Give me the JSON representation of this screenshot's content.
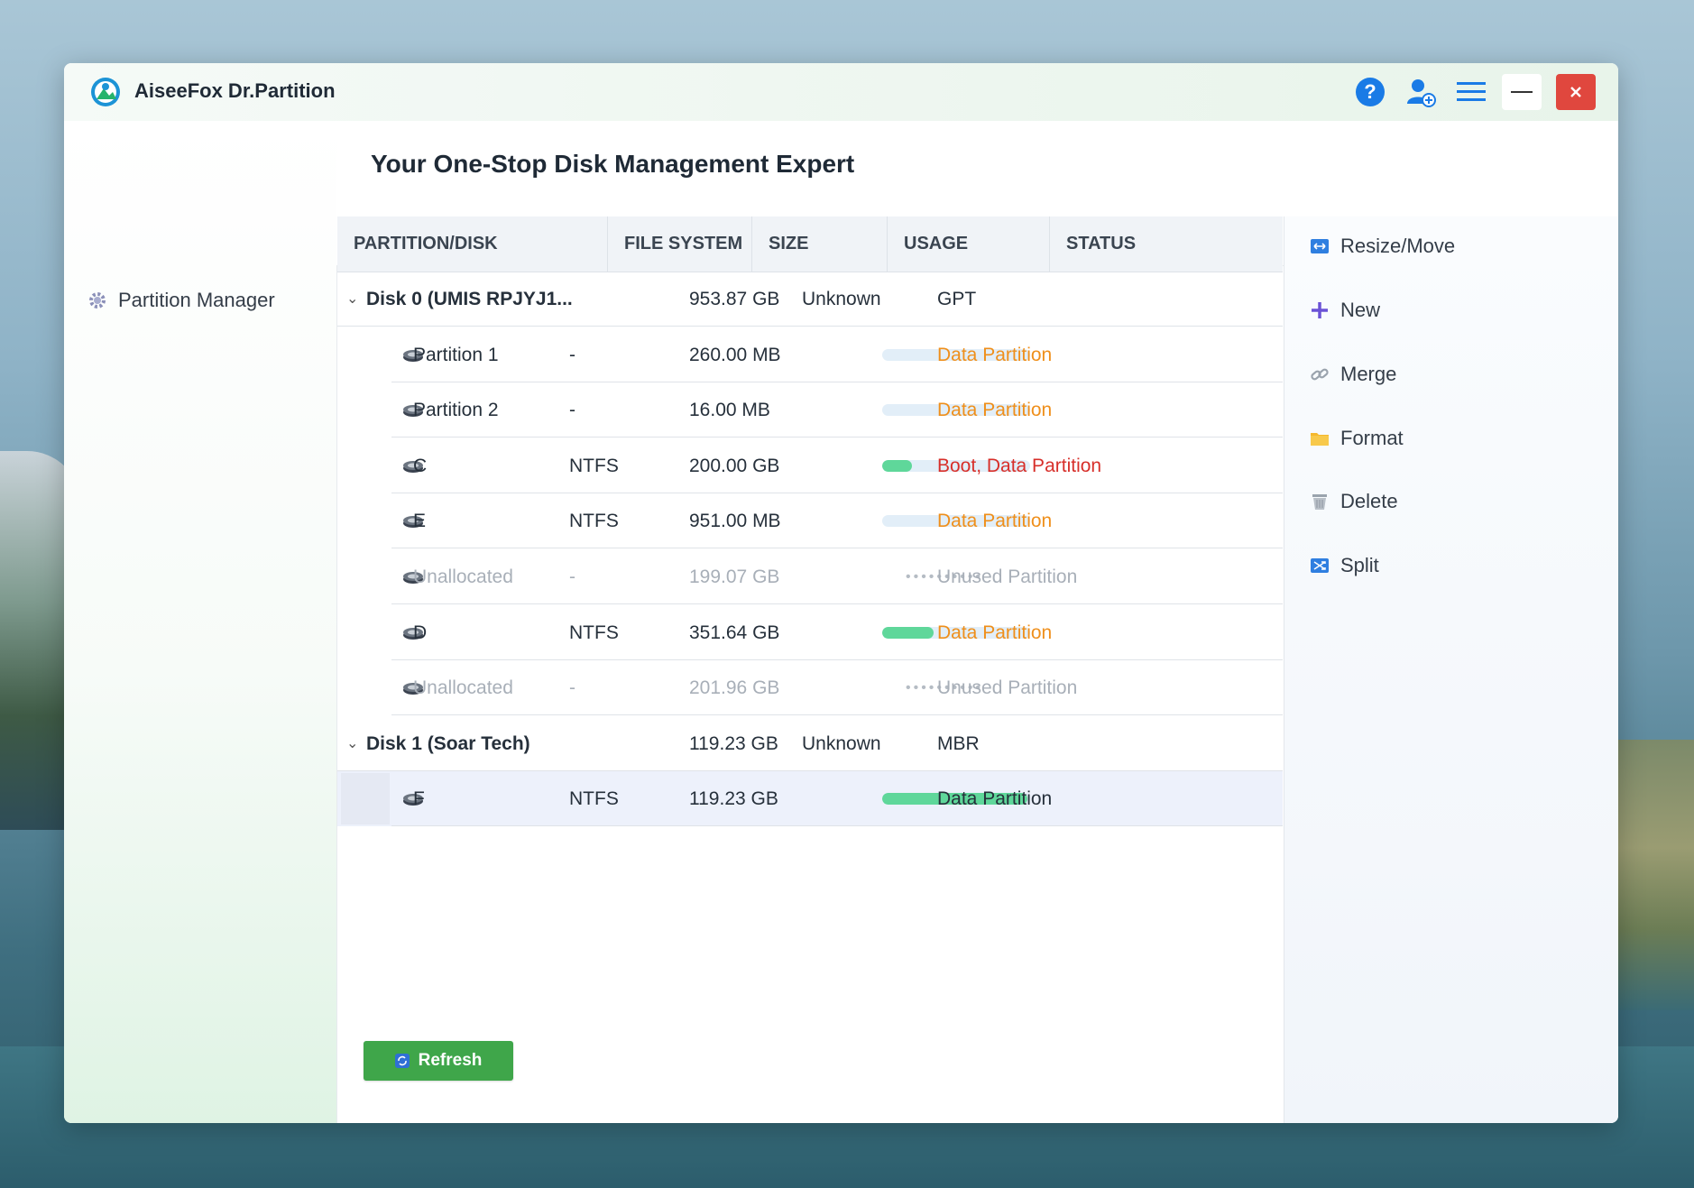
{
  "app": {
    "title": "AiseeFox Dr.Partition"
  },
  "titlebar": {
    "icons": [
      "help-icon",
      "account-icon",
      "menu-icon",
      "minimize-icon",
      "close-icon"
    ],
    "close_color": "#e0473e"
  },
  "sidebar": {
    "items": [
      {
        "label": "Partition Manager",
        "icon": "gear-icon"
      }
    ]
  },
  "main": {
    "title": "Your One-Stop Disk Management Expert"
  },
  "table": {
    "columns": [
      "PARTITION/DISK",
      "FILE SYSTEM",
      "SIZE",
      "USAGE",
      "STATUS"
    ],
    "rows": [
      {
        "kind": "disk",
        "name": "Disk 0 (UMIS RPJYJ1...",
        "fs": "",
        "size": "953.87 GB",
        "usage_text": "Unknown",
        "status": "GPT"
      },
      {
        "kind": "partition",
        "name": "Partition 1",
        "fs": "-",
        "size": "260.00 MB",
        "usage": 0,
        "status": "Data Partition",
        "status_color": "#ef8f1b"
      },
      {
        "kind": "partition",
        "name": "Partition 2",
        "fs": "-",
        "size": "16.00 MB",
        "usage": 0,
        "status": "Data Partition",
        "status_color": "#ef8f1b"
      },
      {
        "kind": "partition",
        "name": "C",
        "fs": "NTFS",
        "size": "200.00 GB",
        "usage": 0.2,
        "status": "Boot, Data Partition",
        "status_color": "#d72f2a"
      },
      {
        "kind": "partition",
        "name": "E",
        "fs": "NTFS",
        "size": "951.00 MB",
        "usage": 0,
        "status": "Data Partition",
        "status_color": "#ef8f1b"
      },
      {
        "kind": "unallocated",
        "name": "Unallocated",
        "fs": "-",
        "size": "199.07 GB",
        "status": "Unused Partition"
      },
      {
        "kind": "partition",
        "name": "D",
        "fs": "NTFS",
        "size": "351.64 GB",
        "usage": 0.35,
        "status": "Data Partition",
        "status_color": "#ef8f1b"
      },
      {
        "kind": "unallocated",
        "name": "Unallocated",
        "fs": "-",
        "size": "201.96 GB",
        "status": "Unused Partition"
      },
      {
        "kind": "disk",
        "name": "Disk 1 (Soar Tech)",
        "fs": "",
        "size": "119.23 GB",
        "usage_text": "Unknown",
        "status": "MBR"
      },
      {
        "kind": "partition",
        "name": "F",
        "fs": "NTFS",
        "size": "119.23 GB",
        "usage": 0.98,
        "status": "Data Partition",
        "status_color": "#26303b",
        "selected": true
      }
    ]
  },
  "actions": [
    {
      "label": "Resize/Move",
      "icon": "resize-move-icon"
    },
    {
      "label": "New",
      "icon": "plus-icon"
    },
    {
      "label": "Merge",
      "icon": "link-icon"
    },
    {
      "label": "Format",
      "icon": "folder-icon"
    },
    {
      "label": "Delete",
      "icon": "trash-icon"
    },
    {
      "label": "Split",
      "icon": "split-icon"
    }
  ],
  "refresh": {
    "label": "Refresh"
  },
  "colors": {
    "accent_green": "#3fa64a",
    "usage_fill": "#5fd79a",
    "warning_orange": "#ef8f1b",
    "boot_red": "#d72f2a"
  }
}
